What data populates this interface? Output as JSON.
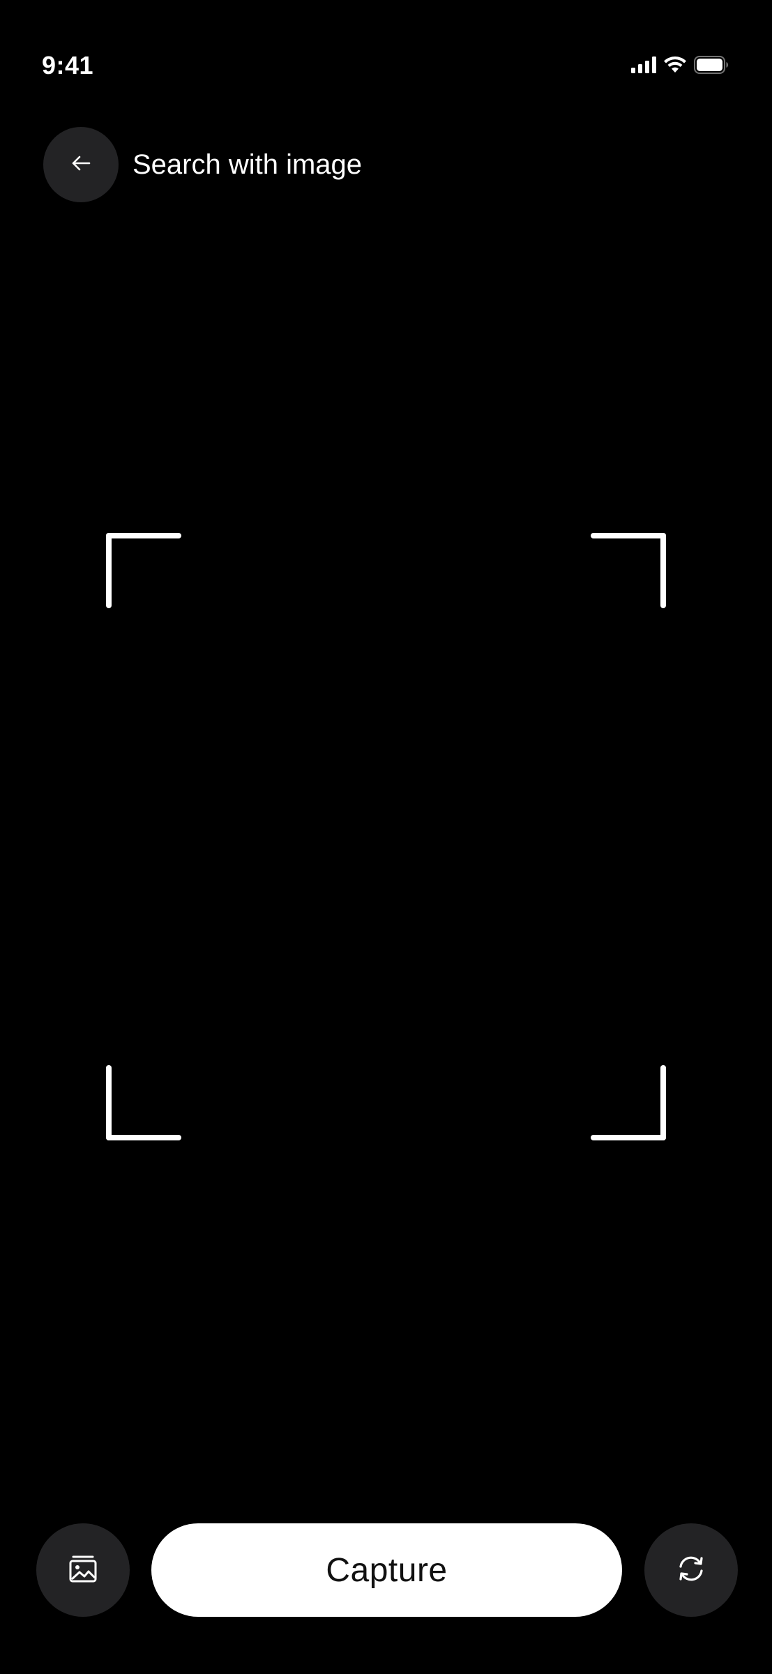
{
  "status_bar": {
    "time": "9:41",
    "icons": [
      "cellular-signal-icon",
      "wifi-icon",
      "battery-icon"
    ]
  },
  "header": {
    "back_icon": "arrow-left-icon",
    "title": "Search with image"
  },
  "viewfinder": {
    "corners": [
      "top-left",
      "top-right",
      "bottom-left",
      "bottom-right"
    ]
  },
  "controls": {
    "gallery_icon": "image-gallery-icon",
    "capture_label": "Capture",
    "flip_icon": "camera-flip-icon"
  },
  "colors": {
    "background": "#000000",
    "control_bg": "#232325",
    "capture_bg": "#ffffff",
    "text": "#ffffff"
  }
}
